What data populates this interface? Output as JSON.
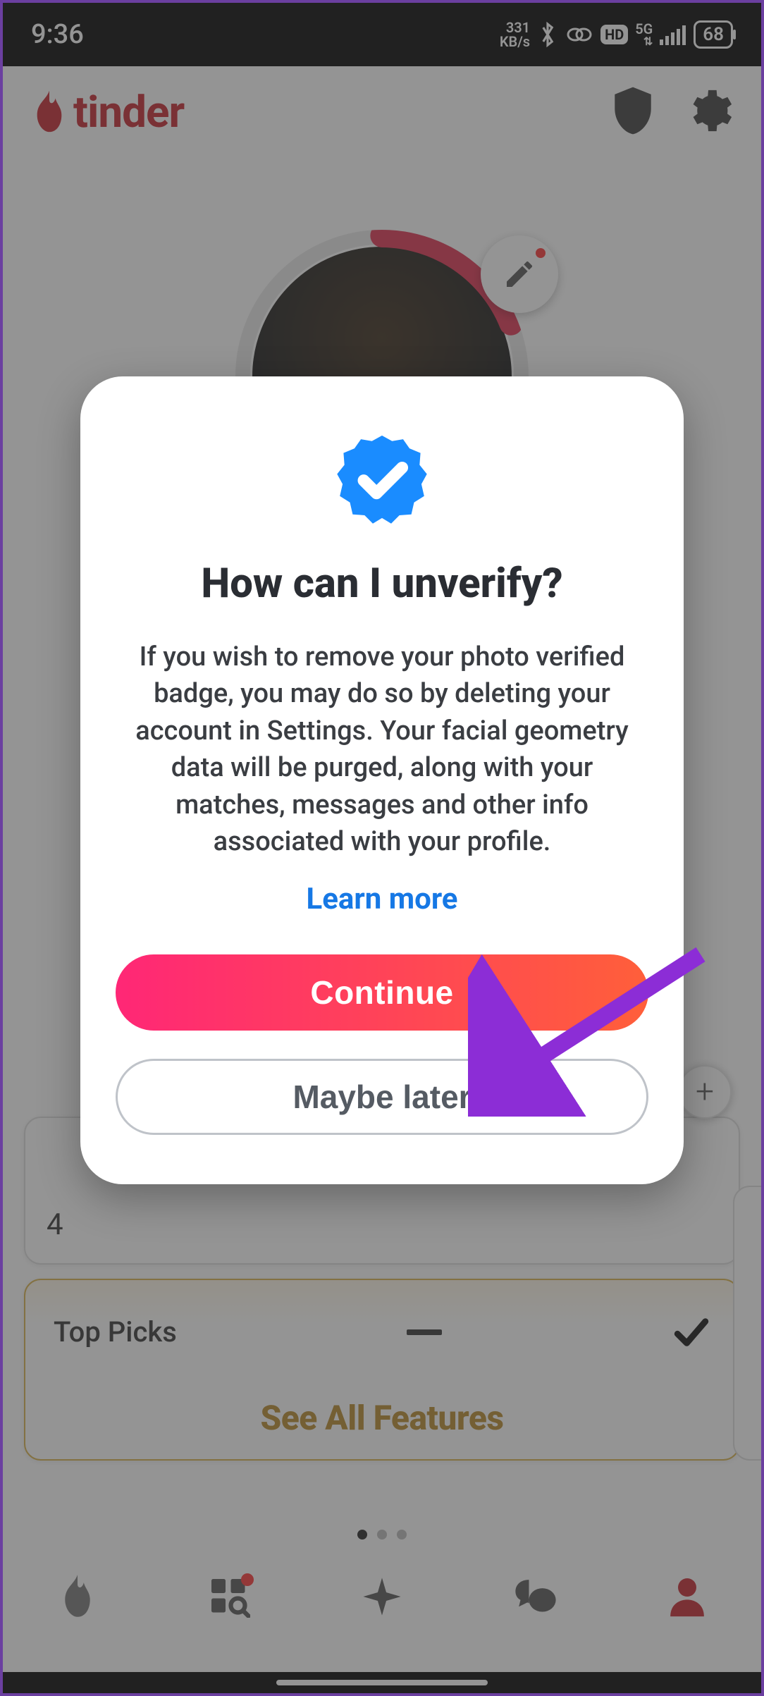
{
  "status": {
    "time": "9:36",
    "net_speed_top": "331",
    "net_speed_bottom": "KB/s",
    "net_type": "5G",
    "battery": "68"
  },
  "header": {
    "brand": "tinder"
  },
  "profile": {
    "card_preview_number": "4",
    "top_picks_label": "Top Picks",
    "see_all": "See All Features"
  },
  "modal": {
    "title": "How can I unverify?",
    "body": "If you wish to remove your photo verified badge, you may do so by deleting your account in Settings. Your facial geometry data will be purged, along with your matches, messages and other info associated with your profile.",
    "learn_more": "Learn more",
    "primary": "Continue",
    "secondary": "Maybe later"
  }
}
